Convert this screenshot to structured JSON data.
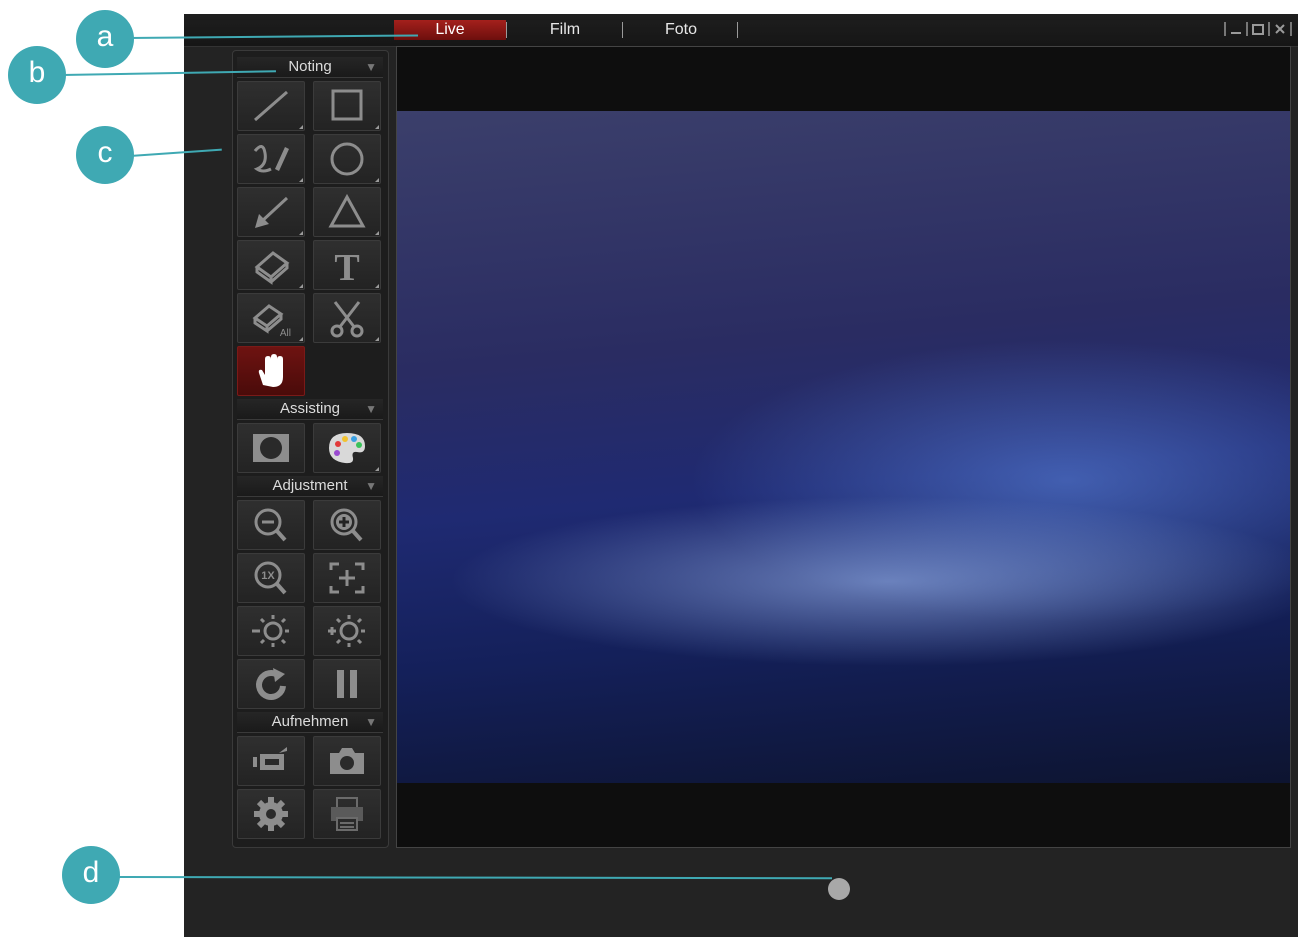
{
  "window": {
    "tabs": [
      {
        "label": "Live",
        "active": true
      },
      {
        "label": "Film",
        "active": false
      },
      {
        "label": "Foto",
        "active": false
      }
    ],
    "controls": [
      "minimize-icon",
      "maximize-icon",
      "close-icon"
    ]
  },
  "panel": {
    "sections": [
      {
        "title": "Noting"
      },
      {
        "title": "Assisting"
      },
      {
        "title": "Adjustment"
      },
      {
        "title": "Aufnehmen"
      }
    ],
    "tools": {
      "noting": [
        "line-icon",
        "rectangle-icon",
        "freehand-icon",
        "circle-icon",
        "arrow-icon",
        "triangle-icon",
        "eraser-icon",
        "text-icon",
        "eraser-all-icon",
        "cut-icon",
        "hand-icon"
      ],
      "eraser_all_text": "All",
      "text_tool_glyph": "T",
      "zoom_1x_text": "1X",
      "assisting": [
        "mask-icon",
        "palette-icon"
      ],
      "adjustment": [
        "zoom-out-icon",
        "zoom-in-icon",
        "zoom-1x-icon",
        "fit-to-screen-icon",
        "brightness-down-icon",
        "brightness-up-icon",
        "rotate-icon",
        "pause-icon"
      ],
      "aufnehmen": [
        "video-record-icon",
        "camera-icon",
        "settings-icon",
        "printer-icon"
      ]
    }
  },
  "callouts": [
    "a",
    "b",
    "c",
    "d"
  ],
  "colors": {
    "accent": "#3fa9b3",
    "active_tab": "#a4201c",
    "background": "#232323"
  }
}
